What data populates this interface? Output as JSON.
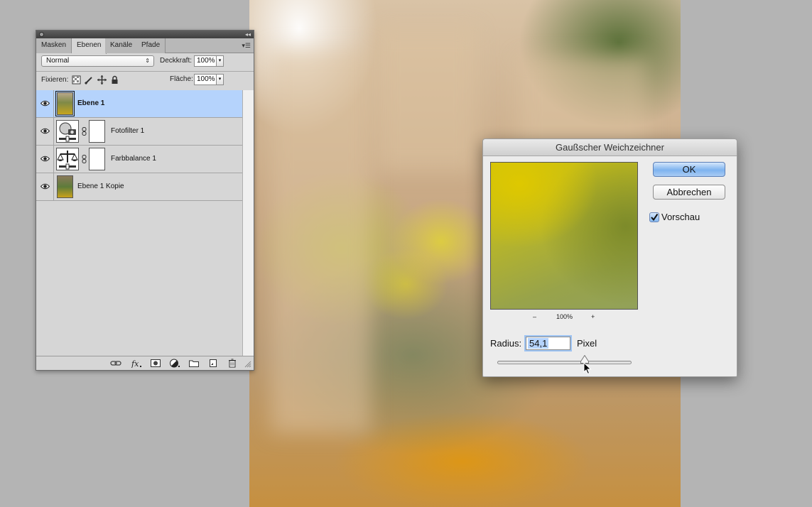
{
  "layers_panel": {
    "tabs": [
      "Masken",
      "Ebenen",
      "Kanäle",
      "Pfade"
    ],
    "active_tab": "Ebenen",
    "blend_mode": "Normal",
    "opacity_label": "Deckkraft:",
    "opacity_value": "100%",
    "lock_label": "Fixieren:",
    "fill_label": "Fläche:",
    "fill_value": "100%",
    "layers": [
      {
        "name": "Ebene 1",
        "type": "pixel",
        "selected": true,
        "visible": true
      },
      {
        "name": "Fotofilter 1",
        "type": "adjustment",
        "icon": "camera-filter-icon",
        "visible": true
      },
      {
        "name": "Farbbalance 1",
        "type": "adjustment",
        "icon": "scale-balance-icon",
        "visible": true
      },
      {
        "name": "Ebene 1 Kopie",
        "type": "pixel",
        "visible": true
      }
    ],
    "bottom_icons": [
      "link-icon",
      "fx-icon",
      "mask-icon",
      "adjustment-icon",
      "folder-icon",
      "new-layer-icon",
      "trash-icon"
    ]
  },
  "dialog": {
    "title": "Gaußscher Weichzeichner",
    "ok_label": "OK",
    "cancel_label": "Abbrechen",
    "preview_label": "Vorschau",
    "preview_checked": true,
    "zoom_minus": "–",
    "zoom_value": "100%",
    "zoom_plus": "+",
    "radius_label": "Radius:",
    "radius_value": "54,1",
    "radius_unit": "Pixel",
    "radius_slider_fraction": 0.65
  },
  "colors": {
    "selection": "#b5d3fc",
    "default_button": "#7eb3ef",
    "panel_bg": "#d6d6d6",
    "dialog_bg": "#ececec",
    "workspace": "#b4b4b4"
  }
}
